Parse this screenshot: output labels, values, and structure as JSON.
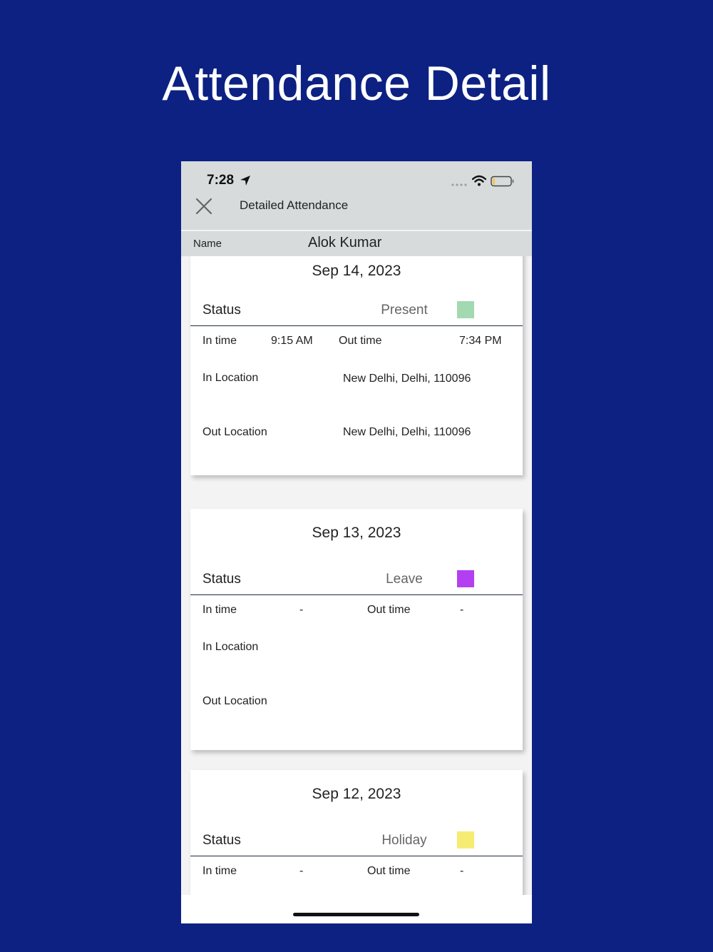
{
  "headline": "Attendance Detail",
  "status_bar": {
    "time": "7:28"
  },
  "nav": {
    "title": "Detailed Attendance",
    "close_icon": "close-icon"
  },
  "employee": {
    "name_label": "Name",
    "name": "Alok Kumar"
  },
  "cards": [
    {
      "date": "Sep 14, 2023",
      "status_label": "Status",
      "status": "Present",
      "status_color": "#a3d9b1",
      "in_time_label": "In time",
      "in_time": "9:15 AM",
      "out_time_label": "Out time",
      "out_time": "7:34 PM",
      "in_location_label": "In Location",
      "in_location": "New Delhi, Delhi, 110096",
      "out_location_label": "Out Location",
      "out_location": "New Delhi, Delhi, 110096"
    },
    {
      "date": "Sep 13, 2023",
      "status_label": "Status",
      "status": "Leave",
      "status_color": "#b43ff2",
      "in_time_label": "In time",
      "in_time": "-",
      "out_time_label": "Out time",
      "out_time": "-",
      "in_location_label": "In Location",
      "in_location": "",
      "out_location_label": "Out Location",
      "out_location": ""
    },
    {
      "date": "Sep 12, 2023",
      "status_label": "Status",
      "status": "Holiday",
      "status_color": "#f7ec73",
      "in_time_label": "In time",
      "in_time": "-",
      "out_time_label": "Out time",
      "out_time": "-"
    }
  ]
}
